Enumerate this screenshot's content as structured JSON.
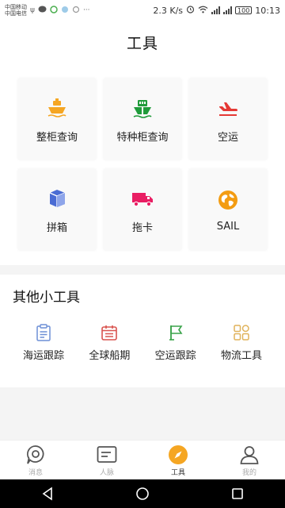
{
  "status_bar": {
    "carrier_1": "中国移动",
    "carrier_2": "中国电信",
    "notif_dots": "···",
    "speed": "2.3 K/s",
    "battery": "100",
    "time": "10:13"
  },
  "header": {
    "title": "工具"
  },
  "tools": [
    {
      "label": "整柜查询",
      "icon": "ship-icon",
      "color": "#f5a623"
    },
    {
      "label": "特种柜查询",
      "icon": "special-ship-icon",
      "color": "#1f9b3a"
    },
    {
      "label": "空运",
      "icon": "airplane-icon",
      "color": "#e53935"
    },
    {
      "label": "拼箱",
      "icon": "box-icon",
      "color": "#4a6cd4"
    },
    {
      "label": "拖卡",
      "icon": "truck-icon",
      "color": "#e91e63"
    },
    {
      "label": "SAIL",
      "icon": "globe-icon",
      "color": "#f39c12"
    }
  ],
  "other_tools": {
    "title": "其他小工具",
    "items": [
      {
        "label": "海运跟踪",
        "icon": "clipboard-icon",
        "color": "#6d8fd6"
      },
      {
        "label": "全球船期",
        "icon": "calendar-icon",
        "color": "#d9534f"
      },
      {
        "label": "空运跟踪",
        "icon": "flag-icon",
        "color": "#3aa34a"
      },
      {
        "label": "物流工具",
        "icon": "grid-tools-icon",
        "color": "#e0b25a"
      }
    ]
  },
  "tab_bar": {
    "items": [
      {
        "label": "消息",
        "icon": "message-icon",
        "active": false
      },
      {
        "label": "人脉",
        "icon": "contacts-icon",
        "active": false
      },
      {
        "label": "工具",
        "icon": "compass-icon",
        "active": true
      },
      {
        "label": "我的",
        "icon": "user-icon",
        "active": false
      }
    ],
    "active_color": "#f5a623"
  }
}
